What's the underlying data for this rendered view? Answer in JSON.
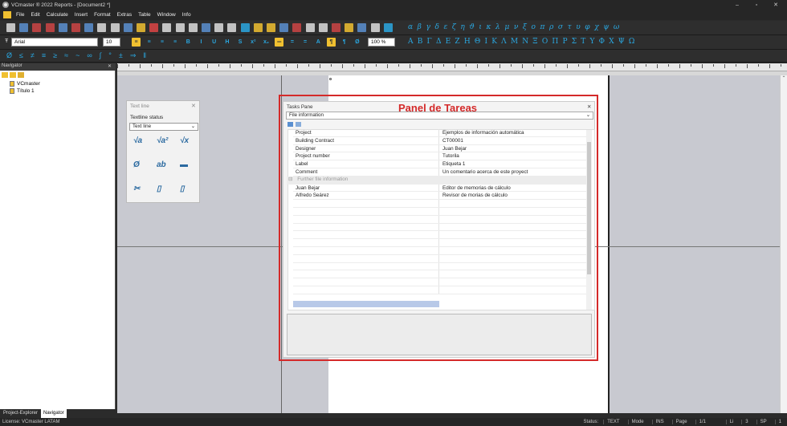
{
  "window": {
    "title": "VCmaster ® 2022 Reports - [Document2 *]"
  },
  "menu": [
    "File",
    "Edit",
    "Calculate",
    "Insert",
    "Format",
    "Extras",
    "Table",
    "Window",
    "Info"
  ],
  "format_bar": {
    "font": "Arial",
    "font_size": "10",
    "zoom": "100 %"
  },
  "greek_lower": [
    "α",
    "β",
    "γ",
    "δ",
    "ε",
    "ζ",
    "η",
    "ϑ",
    "ι",
    "κ",
    "λ",
    "μ",
    "ν",
    "ξ",
    "ο",
    "π",
    "ρ",
    "σ",
    "τ",
    "υ",
    "φ",
    "χ",
    "ψ",
    "ω"
  ],
  "greek_upper": [
    "Α",
    "Β",
    "Γ",
    "Δ",
    "Ε",
    "Ζ",
    "Η",
    "Θ",
    "Ι",
    "Κ",
    "Λ",
    "Μ",
    "Ν",
    "Ξ",
    "Ο",
    "Π",
    "Ρ",
    "Σ",
    "Τ",
    "Υ",
    "Φ",
    "Χ",
    "Ψ",
    "Ω"
  ],
  "math_symbols": [
    "Ø",
    "≤",
    "≠",
    "≡",
    "≥",
    "≈",
    "~",
    "∞",
    "∫",
    "°",
    "±",
    "⇒",
    "‖"
  ],
  "navigator": {
    "header": "Navigator",
    "items": [
      "VCmaster",
      "Título 1"
    ],
    "tabs": [
      "Project-Explorer",
      "Navigator"
    ]
  },
  "textline_panel": {
    "title": "Text line",
    "status_label": "Textline status",
    "selected": "Text line"
  },
  "tasks_pane": {
    "title": "Tasks Pane",
    "annotation": "Panel de Tareas",
    "dropdown": "File information",
    "rows": [
      {
        "key": "Project",
        "value": "Ejemplos de información automática"
      },
      {
        "key": "Building Contract",
        "value": "CT00001"
      },
      {
        "key": "Designer",
        "value": "Juan Bejar"
      },
      {
        "key": "Project number",
        "value": "Tutorila"
      },
      {
        "key": "Label",
        "value": "Etiqueta 1"
      },
      {
        "key": "Comment",
        "value": "Un comentario acerca de este proyect"
      }
    ],
    "section": "Further file information",
    "more_rows": [
      {
        "key": "Juan Bejar",
        "value": "Editor de memorias de cálculo"
      },
      {
        "key": "Alfredo Seárez",
        "value": "Revisor de morias de cálculo"
      }
    ]
  },
  "status": {
    "license": "License: VCmaster LATAM",
    "status_label": "Status:",
    "status_value": "TEXT",
    "mode": "Mode",
    "ins": "INS",
    "page_label": "Page",
    "page_value": "1/1",
    "li_label": "Li",
    "li_value": "3",
    "sp_label": "SP",
    "sp_value": "1"
  },
  "colors": {
    "accent": "#2aa7e0",
    "annotation_red": "#d42a2a",
    "selection": "#b8c9e8"
  }
}
